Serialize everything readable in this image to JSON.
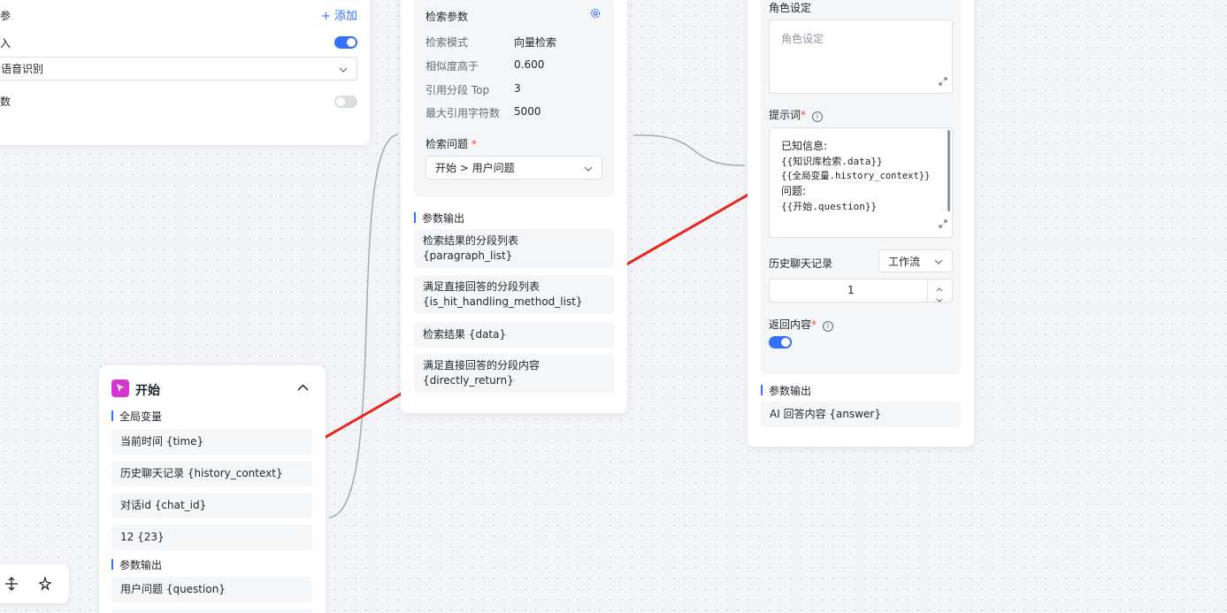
{
  "left_panel": {
    "header_fragment": "参",
    "add_label": "添加",
    "row1_fragment": "入",
    "select_value": "语音识别",
    "row3_fragment": "数"
  },
  "start_node": {
    "title": "开始",
    "global_vars_title": "全局变量",
    "global_vars": [
      "当前时间 {time}",
      "历史聊天记录 {history_context}",
      "对话id {chat_id}",
      "12 {23}"
    ],
    "output_title": "参数输出",
    "outputs": [
      "用户问题 {question}"
    ]
  },
  "search_node": {
    "params_title": "检索参数",
    "params": [
      {
        "label": "检索模式",
        "value": "向量检索"
      },
      {
        "label": "相似度高于",
        "value": "0.600"
      },
      {
        "label": "引用分段 Top",
        "value": "3"
      },
      {
        "label": "最大引用字符数",
        "value": "5000"
      }
    ],
    "question_label": "检索问题",
    "question_value": "开始 > 用户问题",
    "output_title": "参数输出",
    "outputs": [
      [
        "检索结果的分段列表",
        "{paragraph_list}"
      ],
      [
        "满足直接回答的分段列表",
        "{is_hit_handling_method_list}"
      ],
      [
        "检索结果 {data}"
      ],
      [
        "满足直接回答的分段内容",
        "{directly_return}"
      ]
    ]
  },
  "ai_node": {
    "role_label": "角色设定",
    "role_placeholder": "角色设定",
    "prompt_label": "提示词",
    "prompt_lines": [
      "已知信息:",
      "{{知识库检索.data}}",
      "{{全局变量.history_context}}",
      "问题:",
      "{{开始.question}}"
    ],
    "history_label": "历史聊天记录",
    "history_select": "工作流",
    "history_count": "1",
    "return_label": "返回内容",
    "output_title": "参数输出",
    "outputs": [
      "AI 回答内容 {answer}"
    ]
  },
  "colors": {
    "accent": "#3370ff",
    "arrow": "#e8261c",
    "required": "#f54a45"
  }
}
